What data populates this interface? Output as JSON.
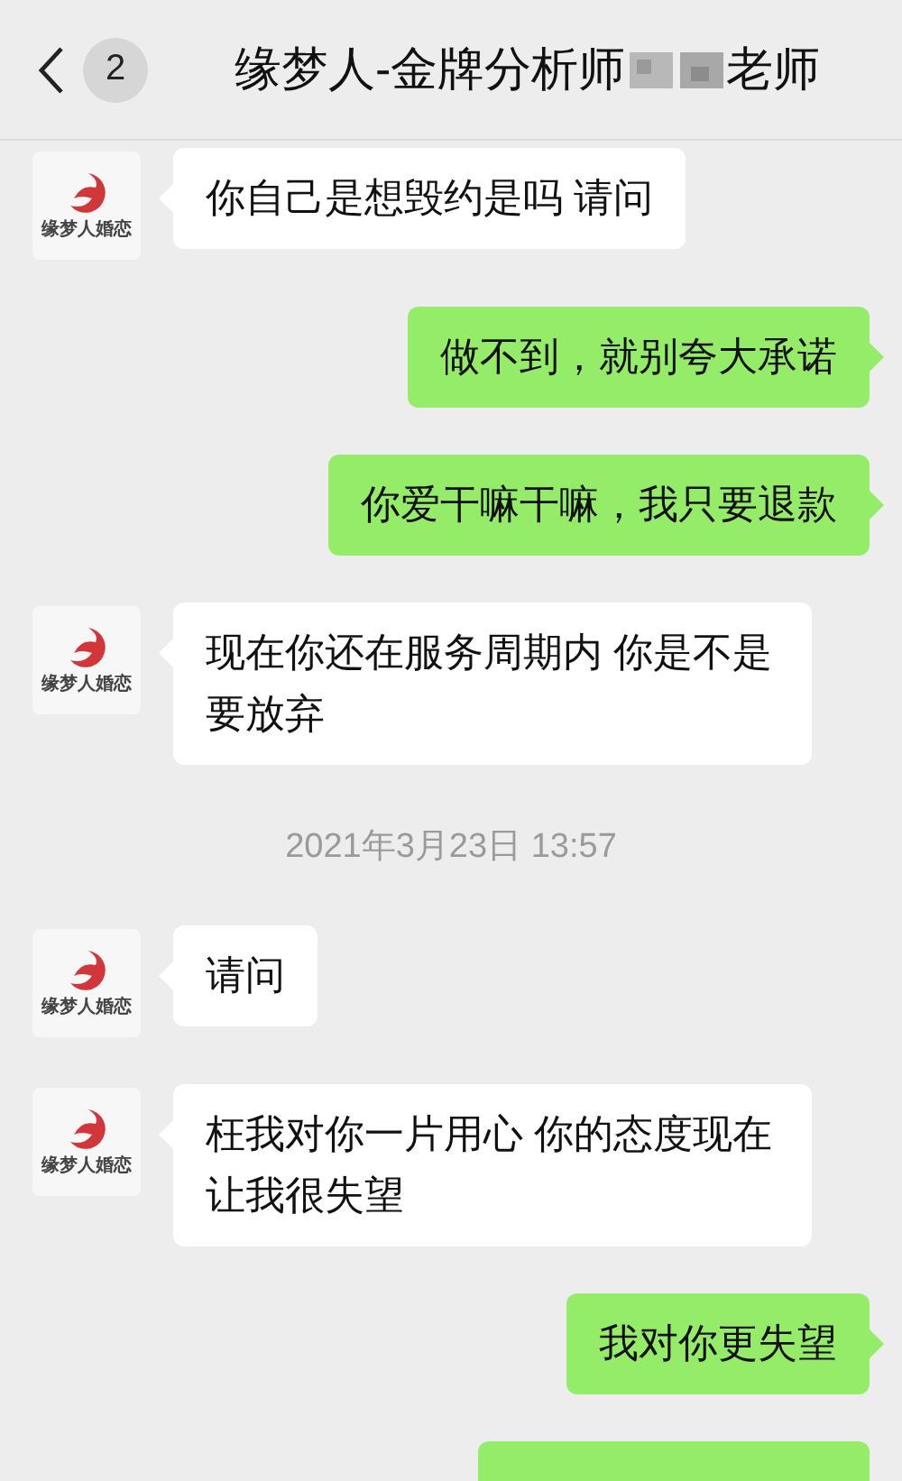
{
  "header": {
    "unread_count": "2",
    "title_prefix": "缘梦人-金牌分析师",
    "title_suffix": "老师",
    "title_redacted": true
  },
  "messages": [
    {
      "kind": "incoming",
      "avatar_label": "缘梦人婚恋",
      "text": "你自己是想毁约是吗 请问"
    },
    {
      "kind": "outgoing",
      "text": "做不到，就别夸大承诺"
    },
    {
      "kind": "outgoing",
      "text": "你爱干嘛干嘛，我只要退款"
    },
    {
      "kind": "incoming",
      "avatar_label": "缘梦人婚恋",
      "text": "现在你还在服务周期内 你是不是要放弃"
    },
    {
      "kind": "time",
      "text": "2021年3月23日 13:57"
    },
    {
      "kind": "incoming",
      "avatar_label": "缘梦人婚恋",
      "text": "请问"
    },
    {
      "kind": "incoming",
      "avatar_label": "缘梦人婚恋",
      "text": "枉我对你一片用心 你的态度现在让我很失望"
    },
    {
      "kind": "outgoing",
      "text": "我对你更失望"
    },
    {
      "kind": "outgoing_cut"
    }
  ]
}
